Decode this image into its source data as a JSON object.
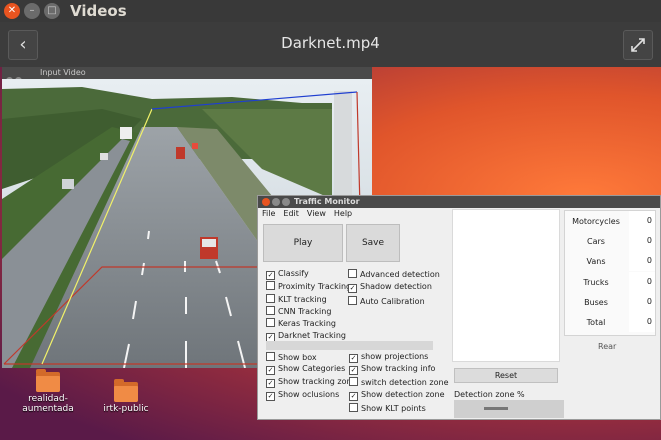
{
  "window": {
    "app_title": "Videos",
    "file_title": "Darknet.mp4"
  },
  "input_video": {
    "title": "Input Video"
  },
  "desktop_icons": [
    {
      "label_line1": "realidad-",
      "label_line2": "aumentada"
    },
    {
      "label_line1": "irtk-public",
      "label_line2": ""
    }
  ],
  "traffic_monitor": {
    "title": "Traffic Monitor",
    "menu": [
      "File",
      "Edit",
      "View",
      "Help"
    ],
    "play_label": "Play",
    "save_label": "Save",
    "options_left": [
      {
        "label": "Classify",
        "checked": true
      },
      {
        "label": "Proximity Tracking",
        "checked": false
      },
      {
        "label": "KLT tracking",
        "checked": false
      },
      {
        "label": "CNN Tracking",
        "checked": false
      },
      {
        "label": "Keras Tracking",
        "checked": false
      },
      {
        "label": "Darknet Tracking",
        "checked": true
      }
    ],
    "options_mid": [
      {
        "label": "Advanced detection",
        "checked": false
      },
      {
        "label": "Shadow detection",
        "checked": true
      },
      {
        "label": "Auto Calibration",
        "checked": false
      }
    ],
    "display_left": [
      {
        "label": "Show box",
        "checked": false
      },
      {
        "label": "Show Categories",
        "checked": true
      },
      {
        "label": "Show tracking zone",
        "checked": true
      },
      {
        "label": "Show oclusions",
        "checked": true
      }
    ],
    "display_right": [
      {
        "label": "show projections",
        "checked": true
      },
      {
        "label": "Show tracking info",
        "checked": true
      },
      {
        "label": "switch detection zone",
        "checked": false
      },
      {
        "label": "Show detection zone",
        "checked": true
      },
      {
        "label": "Show KLT points",
        "checked": false
      }
    ],
    "reset_label": "Reset",
    "detection_zone_label": "Detection zone %",
    "counts": [
      {
        "label": "Motorcycles",
        "value": "0"
      },
      {
        "label": "Cars",
        "value": "0"
      },
      {
        "label": "Vans",
        "value": "0"
      },
      {
        "label": "Trucks",
        "value": "0"
      },
      {
        "label": "Buses",
        "value": "0"
      },
      {
        "label": "Total",
        "value": "0"
      }
    ],
    "rear_label": "Rear"
  }
}
